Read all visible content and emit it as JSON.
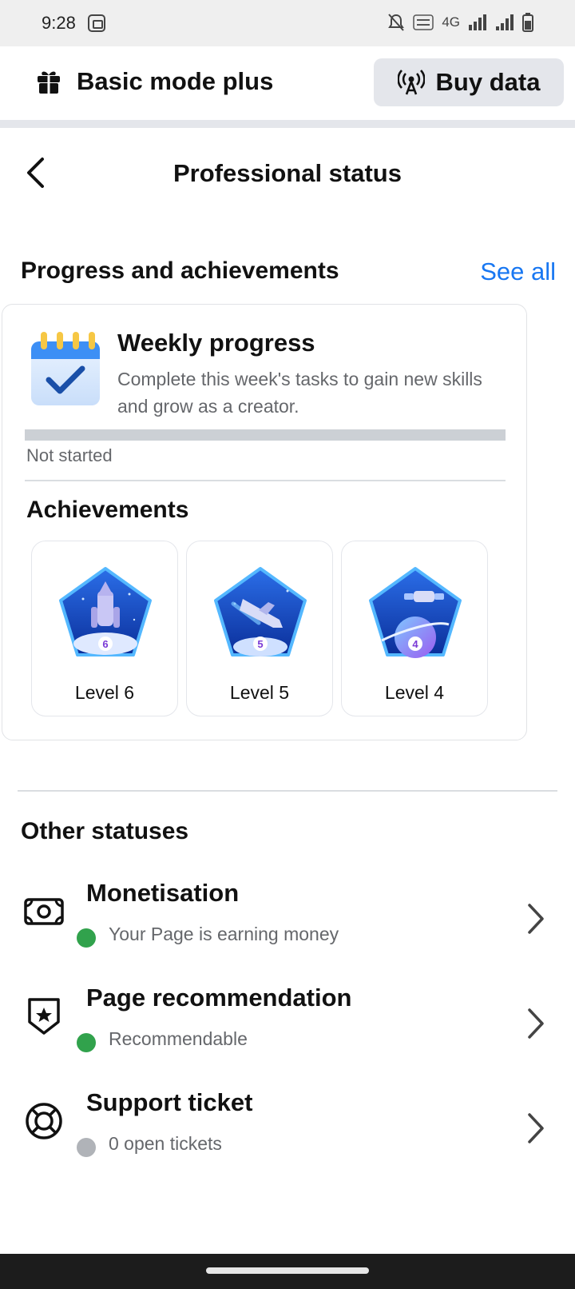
{
  "status_bar": {
    "time": "9:28",
    "network": "4G"
  },
  "mode_bar": {
    "label": "Basic mode plus",
    "buy_label": "Buy data"
  },
  "header": {
    "title": "Professional status"
  },
  "progress_section": {
    "title": "Progress and achievements",
    "see_all": "See all"
  },
  "weekly": {
    "title": "Weekly progress",
    "description": "Complete this week's tasks to gain new skills and grow as a creator.",
    "progress_fraction": 0,
    "status": "Not started"
  },
  "achievements": {
    "title": "Achievements",
    "items": [
      {
        "label": "Level 6",
        "number": "6"
      },
      {
        "label": "Level 5",
        "number": "5"
      },
      {
        "label": "Level 4",
        "number": "4"
      }
    ]
  },
  "other": {
    "title": "Other statuses",
    "items": [
      {
        "title": "Monetisation",
        "subtitle": "Your Page is earning money",
        "icon": "money-icon",
        "dot_color": "#31a24c"
      },
      {
        "title": "Page recommendation",
        "subtitle": "Recommendable",
        "icon": "shield-star-icon",
        "dot_color": "#31a24c"
      },
      {
        "title": "Support ticket",
        "subtitle": "0 open tickets",
        "icon": "lifebuoy-icon",
        "dot_color": "#b0b3b8"
      }
    ]
  },
  "colors": {
    "accent": "#1877f2",
    "success": "#31a24c",
    "neutral": "#b0b3b8"
  }
}
